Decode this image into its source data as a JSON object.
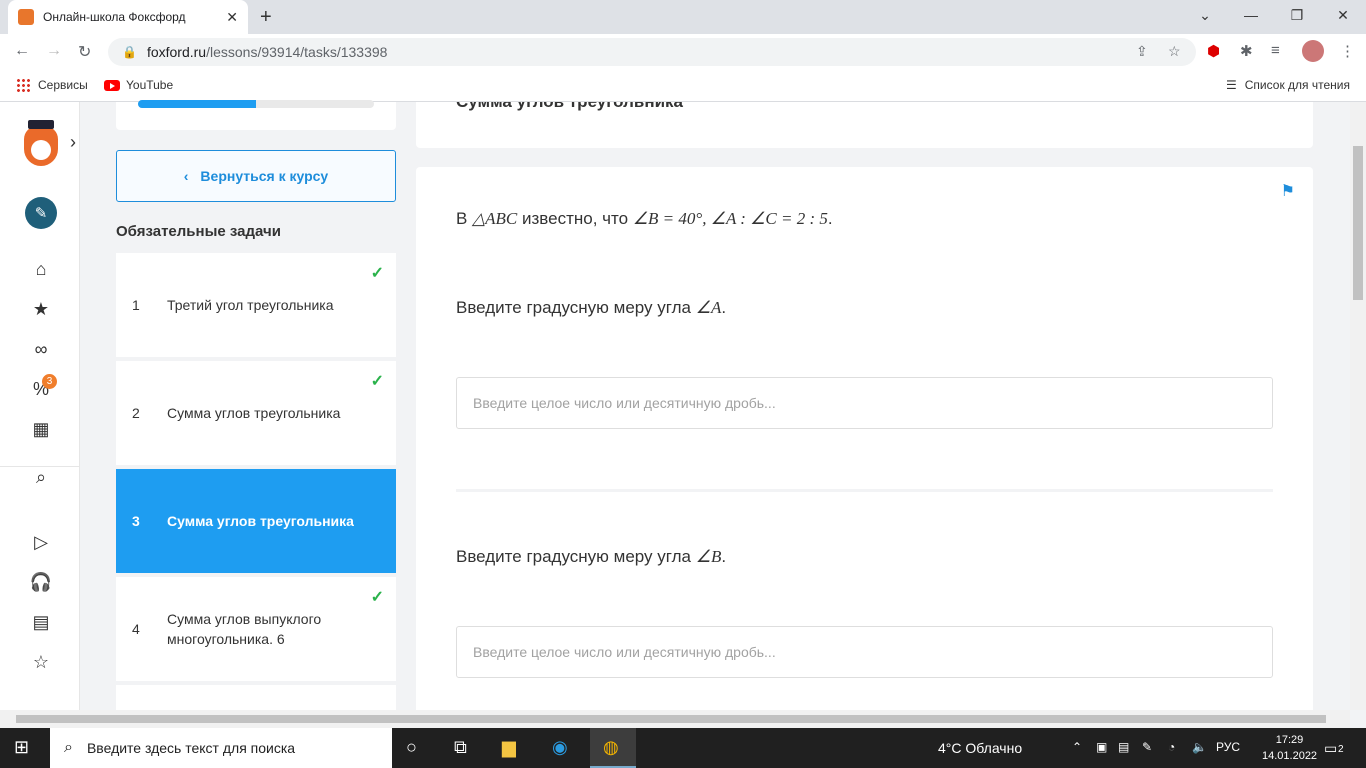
{
  "browser": {
    "tab_title": "Онлайн-школа Фоксфорд",
    "url_host": "foxford.ru",
    "url_path": "/lessons/93914/tasks/133398",
    "bookmarks": [
      "Сервисы",
      "YouTube"
    ],
    "reading_list": "Список для чтения"
  },
  "sidebar": {
    "progress": 0.5,
    "back_label": "Вернуться к курсу",
    "section_title": "Обязательные задачи",
    "notifications": "3",
    "tasks": [
      {
        "num": "1",
        "name": "Третий угол треугольника",
        "done": true
      },
      {
        "num": "2",
        "name": "Сумма углов треугольника",
        "done": true
      },
      {
        "num": "3",
        "name": "Сумма углов треугольника",
        "active": true
      },
      {
        "num": "4",
        "name": "Сумма углов выпуклого многоугольника. 6",
        "done": true
      }
    ]
  },
  "main": {
    "top_title": "Сумма углов треугольника",
    "statement_prefix": "В",
    "statement_triangle": "△ABC",
    "statement_mid": "известно, что",
    "statement_math": "∠B = 40°, ∠A : ∠C = 2 : 5",
    "statement_end": ".",
    "q1_text": "Введите градусную меру угла",
    "q1_math": "∠A",
    "q2_text": "Введите градусную меру угла",
    "q2_math": "∠B",
    "dot": ".",
    "input_placeholder": "Введите целое число или десятичную дробь..."
  },
  "taskbar": {
    "search_placeholder": "Введите здесь текст для поиска",
    "weather": "4°C Облачно",
    "lang": "РУС",
    "time": "17:29",
    "date": "14.01.2022",
    "notif_count": "2"
  }
}
